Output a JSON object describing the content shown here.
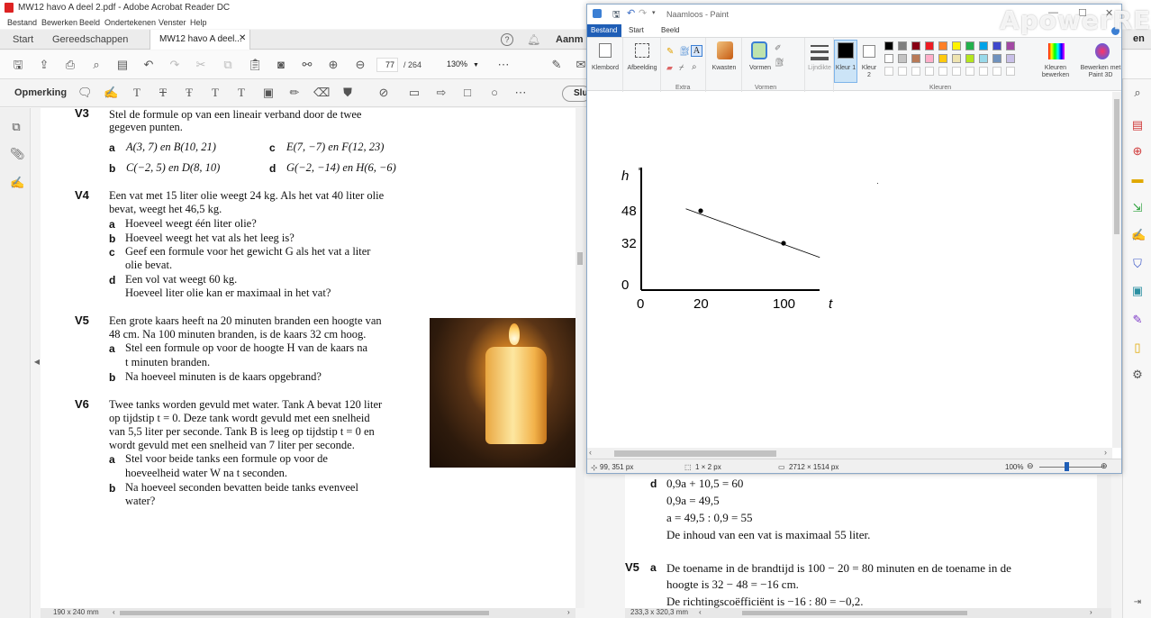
{
  "acrobat": {
    "title": "MW12 havo A deel 2.pdf - Adobe Acrobat Reader DC",
    "menu": [
      "Bestand",
      "Bewerken",
      "Beeld",
      "Ondertekenen",
      "Venster",
      "Help"
    ],
    "tabs": {
      "start": "Start",
      "tools": "Gereedschappen",
      "doc": "MW12 havo A deel...",
      "signin": "Aanm"
    },
    "toolbar": {
      "page_current": "77",
      "page_total": "/ 264",
      "zoom": "130%"
    },
    "comment_label": "Opmerking",
    "close_label": "Slu",
    "status_left": "190 x 240 mm",
    "status_right": "233,3 x 320,3 mm",
    "right_edge_text": "en"
  },
  "document": {
    "v3": {
      "label": "V3",
      "text1": "Stel de formule op van een lineair verband door de twee",
      "text2": "gegeven punten.",
      "a": "A(3, 7) en B(10, 21)",
      "b": "C(−2, 5) en D(8, 10)",
      "c": "E(7, −7) en F(12, 23)",
      "d": "G(−2, −14) en H(6, −6)"
    },
    "v4": {
      "label": "V4",
      "text1": "Een vat met 15 liter olie weegt 24 kg. Als het vat 40 liter olie",
      "text2": "bevat, weegt het 46,5 kg.",
      "a": "Hoeveel weegt één liter olie?",
      "b": "Hoeveel weegt het vat als het leeg is?",
      "c1": "Geef een formule voor het gewicht G als het vat a liter",
      "c2": "olie bevat.",
      "d1": "Een vol vat weegt 60 kg.",
      "d2": "Hoeveel liter olie kan er maximaal in het vat?"
    },
    "v5": {
      "label": "V5",
      "text1": "Een grote kaars heeft na 20 minuten branden een hoogte van",
      "text2": "48 cm. Na 100 minuten branden, is de kaars 32 cm hoog.",
      "a1": "Stel een formule op voor de hoogte H van de kaars na",
      "a2": "t minuten branden.",
      "b": "Na hoeveel minuten is de kaars opgebrand?"
    },
    "v6": {
      "label": "V6",
      "text1": "Twee tanks worden gevuld met water. Tank A bevat 120 liter",
      "text2": "op tijdstip t = 0. Deze tank wordt gevuld met een snelheid",
      "text3": "van 5,5 liter per seconde. Tank B is leeg op tijdstip t = 0 en",
      "text4": "wordt gevuld met een snelheid van 7 liter per seconde.",
      "a1": "Stel voor beide tanks een formule op voor de",
      "a2": "hoeveelheid water W na t seconden.",
      "b1": "Na hoeveel seconden bevatten beide tanks evenveel",
      "b2": "water?"
    },
    "letters": {
      "a": "a",
      "b": "b",
      "c": "c",
      "d": "d"
    }
  },
  "answers": {
    "d_label": "d",
    "d1": "0,9a + 10,5 = 60",
    "d2": "0,9a = 49,5",
    "d3": "a = 49,5 : 0,9 = 55",
    "d4": "De inhoud van een vat is maximaal 55 liter.",
    "v5_label": "V5",
    "a_label": "a",
    "v5a1": "De toename in de brandtijd is 100 − 20 = 80 minuten en de toename in de",
    "v5a2": "hoogte is 32 − 48 = −16 cm.",
    "v5a3": "De richtingscoëfficiënt is −16 : 80 = −0,2."
  },
  "paint": {
    "title": "Naamloos - Paint",
    "tabs": {
      "file": "Bestand",
      "start": "Start",
      "view": "Beeld"
    },
    "groups": {
      "clipboard": "Klembord",
      "image": "Afbeelding",
      "tools": "Extra",
      "brushes": "Kwasten",
      "shapes": "Vormen",
      "shapes_group": "Vormen",
      "size": "Lijndikte",
      "color1": "Kleur 1",
      "color2": "Kleur 2",
      "colors": "Kleuren",
      "edit_colors": "Kleuren bewerken",
      "paint3d": "Bewerken met Paint 3D"
    },
    "palette": [
      "#000000",
      "#7f7f7f",
      "#880015",
      "#ed1c24",
      "#ff7f27",
      "#fff200",
      "#22b14c",
      "#00a2e8",
      "#3f48cc",
      "#a349a4",
      "#ffffff",
      "#c3c3c3",
      "#b97a57",
      "#ffaec9",
      "#ffc90e",
      "#efe4b0",
      "#b5e61d",
      "#99d9ea",
      "#7092be",
      "#c8bfe7"
    ],
    "status": {
      "cursor": "99, 351 px",
      "selection": "1 × 2 px",
      "size": "2712 × 1514 px",
      "zoom": "100%"
    }
  },
  "chart_data": {
    "type": "line",
    "xlabel": "t",
    "ylabel": "h",
    "x_ticks": [
      "0",
      "20",
      "100"
    ],
    "y_ticks": [
      "0",
      "32",
      "48"
    ],
    "points": [
      {
        "x": 20,
        "y": 48
      },
      {
        "x": 100,
        "y": 32
      }
    ],
    "line_extent": {
      "x": [
        15,
        135
      ],
      "y": [
        49,
        25
      ]
    }
  },
  "watermark": "ApowerREC"
}
